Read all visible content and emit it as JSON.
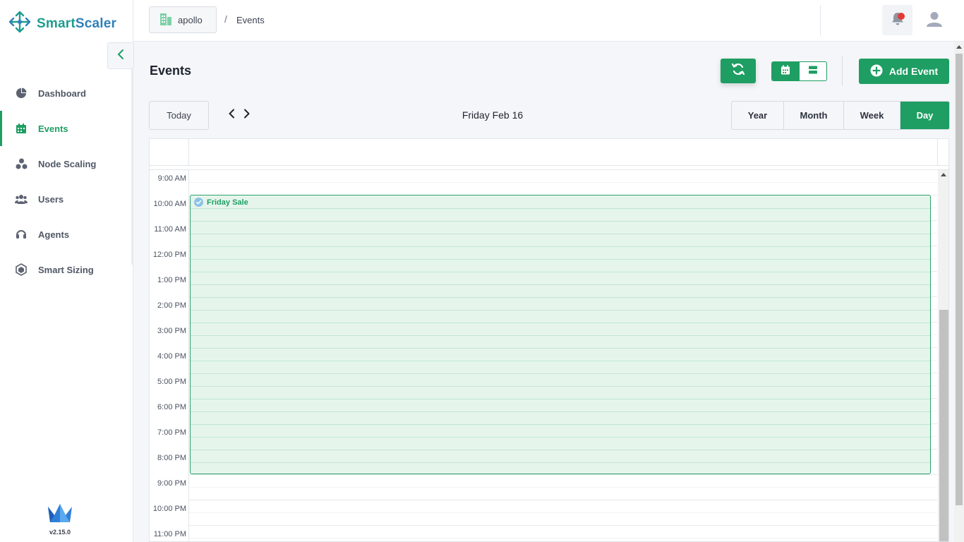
{
  "app": {
    "brand_part1": "Smart",
    "brand_part2": "Scaler",
    "version": "v2.15.0",
    "brand_colors": {
      "primary": "#1e9e63",
      "logo_teal": "#1f9c8e",
      "logo_blue": "#2f80b8"
    }
  },
  "sidebar": {
    "items": [
      {
        "label": "Dashboard",
        "icon": "pie-chart-icon",
        "active": false
      },
      {
        "label": "Events",
        "icon": "calendar-icon",
        "active": true
      },
      {
        "label": "Node Scaling",
        "icon": "nodes-icon",
        "active": false
      },
      {
        "label": "Users",
        "icon": "users-icon",
        "active": false
      },
      {
        "label": "Agents",
        "icon": "headset-icon",
        "active": false
      },
      {
        "label": "Smart Sizing",
        "icon": "sizing-icon",
        "active": false
      }
    ]
  },
  "topbar": {
    "tenant": "apollo",
    "breadcrumb_separator": "/",
    "breadcrumb_page": "Events",
    "notification_badge_color": "#e53935"
  },
  "main": {
    "title": "Events",
    "add_event_label": "Add Event",
    "today_label": "Today",
    "current_date": "Friday Feb 16",
    "ranges": [
      "Year",
      "Month",
      "Week",
      "Day"
    ],
    "active_range": "Day",
    "view_mode": "calendar"
  },
  "calendar": {
    "hours": [
      "9:00 AM",
      "10:00 AM",
      "11:00 AM",
      "12:00 PM",
      "1:00 PM",
      "2:00 PM",
      "3:00 PM",
      "4:00 PM",
      "5:00 PM",
      "6:00 PM",
      "7:00 PM",
      "8:00 PM",
      "9:00 PM",
      "10:00 PM",
      "11:00 PM"
    ],
    "event": {
      "title": "Friday Sale",
      "start": "10:00 AM",
      "end": "9:00 PM"
    }
  }
}
